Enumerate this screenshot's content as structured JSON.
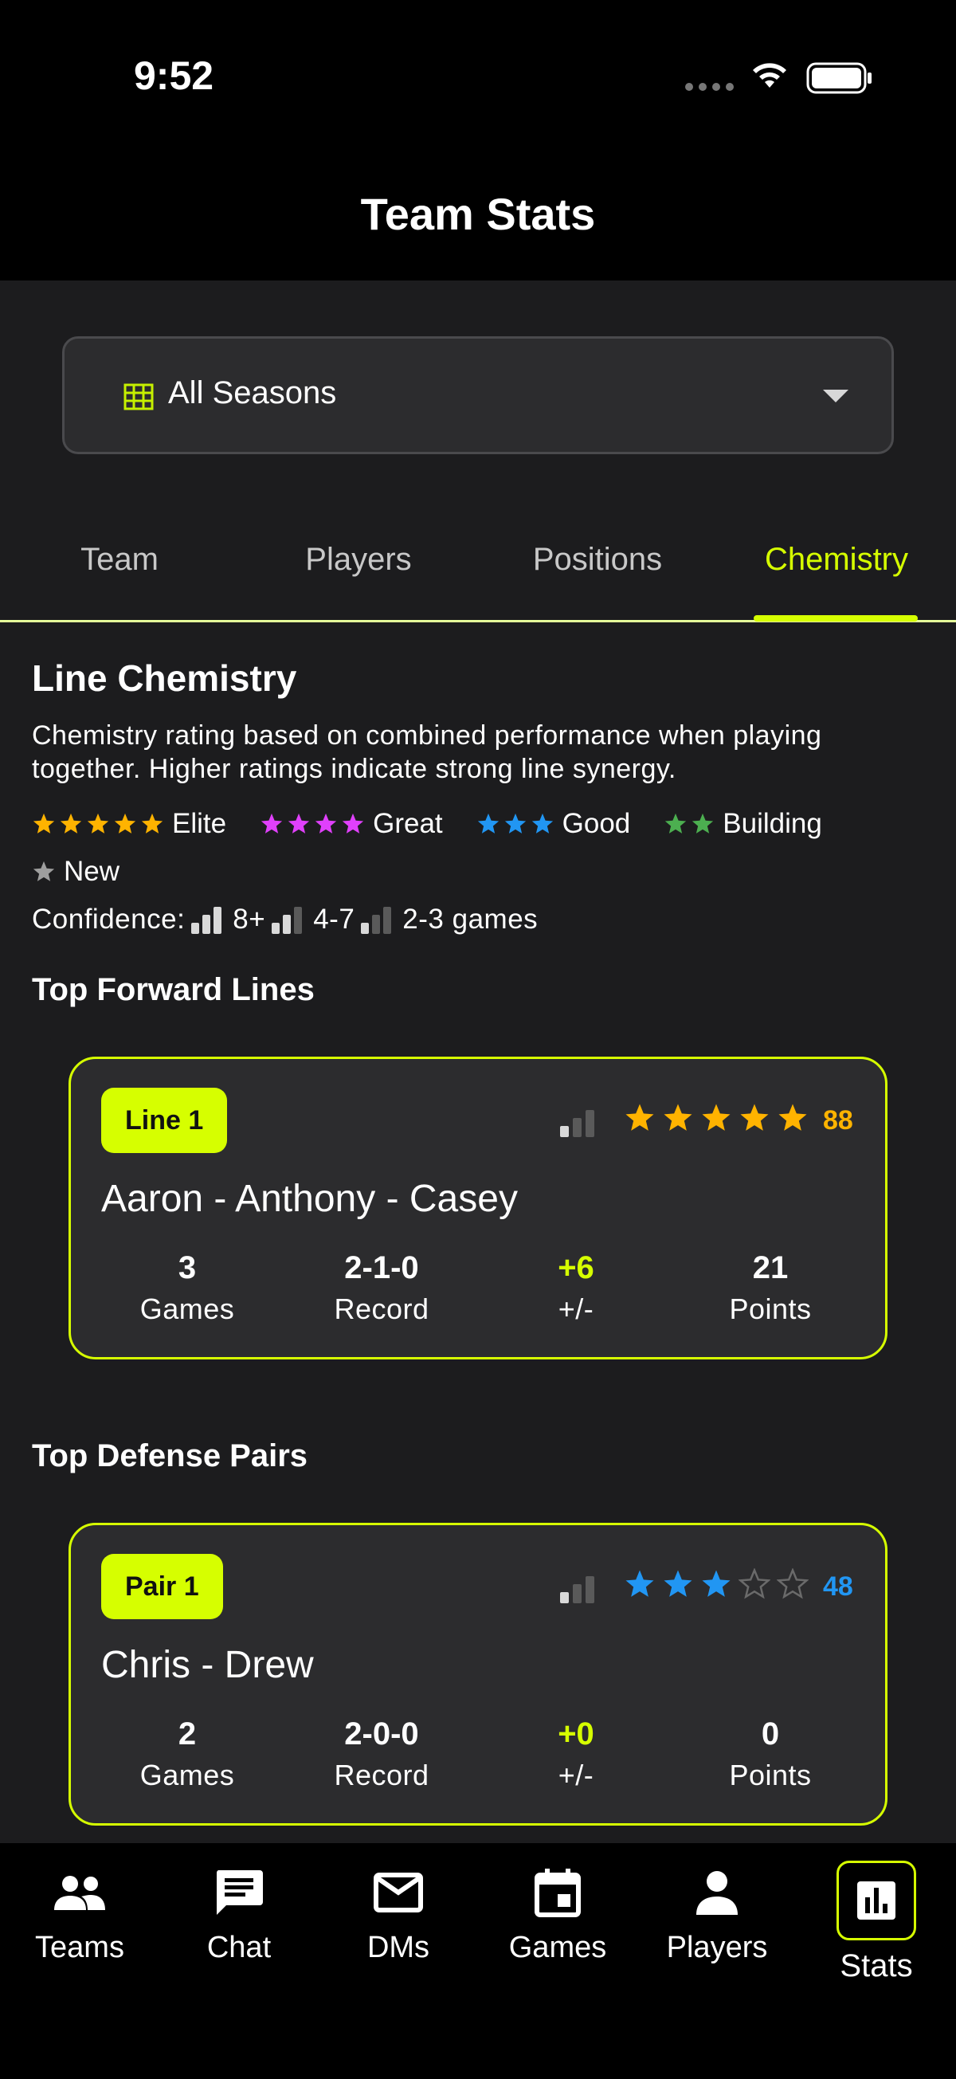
{
  "status_bar": {
    "time": "9:52"
  },
  "header": {
    "title": "Team Stats"
  },
  "season_select": {
    "value": "All Seasons"
  },
  "tabs": [
    {
      "label": "Team",
      "active": false
    },
    {
      "label": "Players",
      "active": false
    },
    {
      "label": "Positions",
      "active": false
    },
    {
      "label": "Chemistry",
      "active": true
    }
  ],
  "chemistry": {
    "title": "Line Chemistry",
    "description": "Chemistry rating based on combined performance when playing together. Higher ratings indicate strong line synergy.",
    "legend": [
      {
        "stars": 5,
        "label": "Elite",
        "color": "#ffb300"
      },
      {
        "stars": 4,
        "label": "Great",
        "color": "#e040fb"
      },
      {
        "stars": 3,
        "label": "Good",
        "color": "#2196f3"
      },
      {
        "stars": 2,
        "label": "Building",
        "color": "#4caf50"
      },
      {
        "stars": 1,
        "label": "New",
        "color": "#9e9e9e"
      }
    ],
    "confidence": {
      "prefix": "Confidence:",
      "levels": [
        {
          "bars": 3,
          "label": "8+"
        },
        {
          "bars": 2,
          "label": "4-7"
        },
        {
          "bars": 1,
          "label": "2-3 games"
        }
      ]
    }
  },
  "forward_lines": {
    "title": "Top Forward Lines",
    "items": [
      {
        "badge": "Line 1",
        "confidence_bars": 1,
        "stars": 5,
        "star_color": "#ffb300",
        "rating": "88",
        "names": "Aaron - Anthony - Casey",
        "stats": {
          "games": "3",
          "games_label": "Games",
          "record": "2-1-0",
          "record_label": "Record",
          "plus_minus": "+6",
          "plus_minus_label": "+/-",
          "points": "21",
          "points_label": "Points"
        }
      }
    ]
  },
  "defense_pairs": {
    "title": "Top Defense Pairs",
    "items": [
      {
        "badge": "Pair 1",
        "confidence_bars": 1,
        "stars": 3,
        "star_color": "#2196f3",
        "rating": "48",
        "names": "Chris - Drew",
        "stats": {
          "games": "2",
          "games_label": "Games",
          "record": "2-0-0",
          "record_label": "Record",
          "plus_minus": "+0",
          "plus_minus_label": "+/-",
          "points": "0",
          "points_label": "Points"
        }
      }
    ]
  },
  "bottom_nav": [
    {
      "label": "Teams",
      "icon": "people-icon",
      "active": false
    },
    {
      "label": "Chat",
      "icon": "chat-icon",
      "active": false
    },
    {
      "label": "DMs",
      "icon": "mail-icon",
      "active": false
    },
    {
      "label": "Games",
      "icon": "calendar-icon",
      "active": false
    },
    {
      "label": "Players",
      "icon": "person-icon",
      "active": false
    },
    {
      "label": "Stats",
      "icon": "bar-chart-icon",
      "active": true
    }
  ],
  "colors": {
    "accent": "#d6ff00",
    "background": "#1c1c1e",
    "surface": "#2c2c2e"
  }
}
